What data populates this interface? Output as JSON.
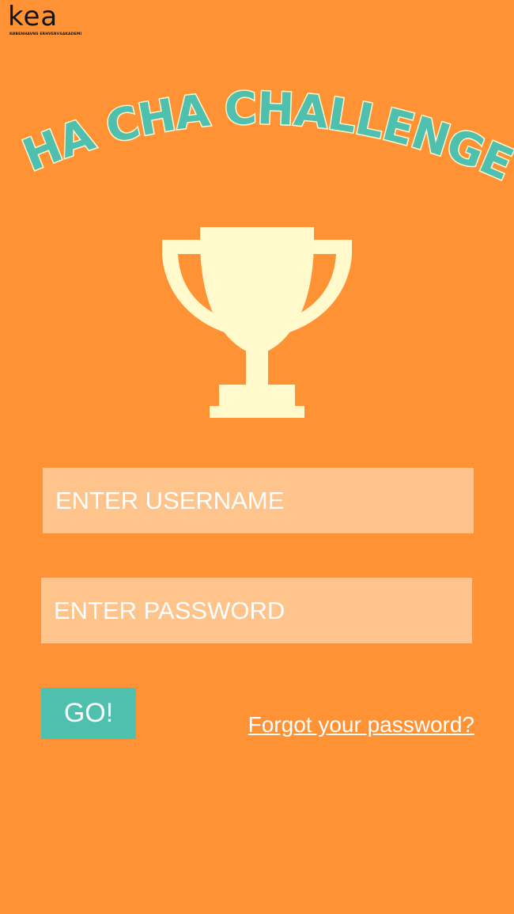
{
  "logo": {
    "wordmark": "kea",
    "subtitle": "KØBENHAVNS ERHVERVSAKADEMI"
  },
  "title": "CHA CHA CHALLENGE!",
  "trophy_icon": "trophy-icon",
  "form": {
    "username_placeholder": "ENTER USERNAME",
    "password_placeholder": "ENTER PASSWORD",
    "submit_label": "GO!",
    "forgot_label": "Forgot your password?"
  },
  "colors": {
    "background": "#FF9235",
    "title": "#4FBFAE",
    "title_outline": "#FFF6CF",
    "trophy": "#FFF9CC",
    "input_bg": "#FFC38C",
    "button_bg": "#4FBFAE",
    "text": "#FFFFFF"
  }
}
